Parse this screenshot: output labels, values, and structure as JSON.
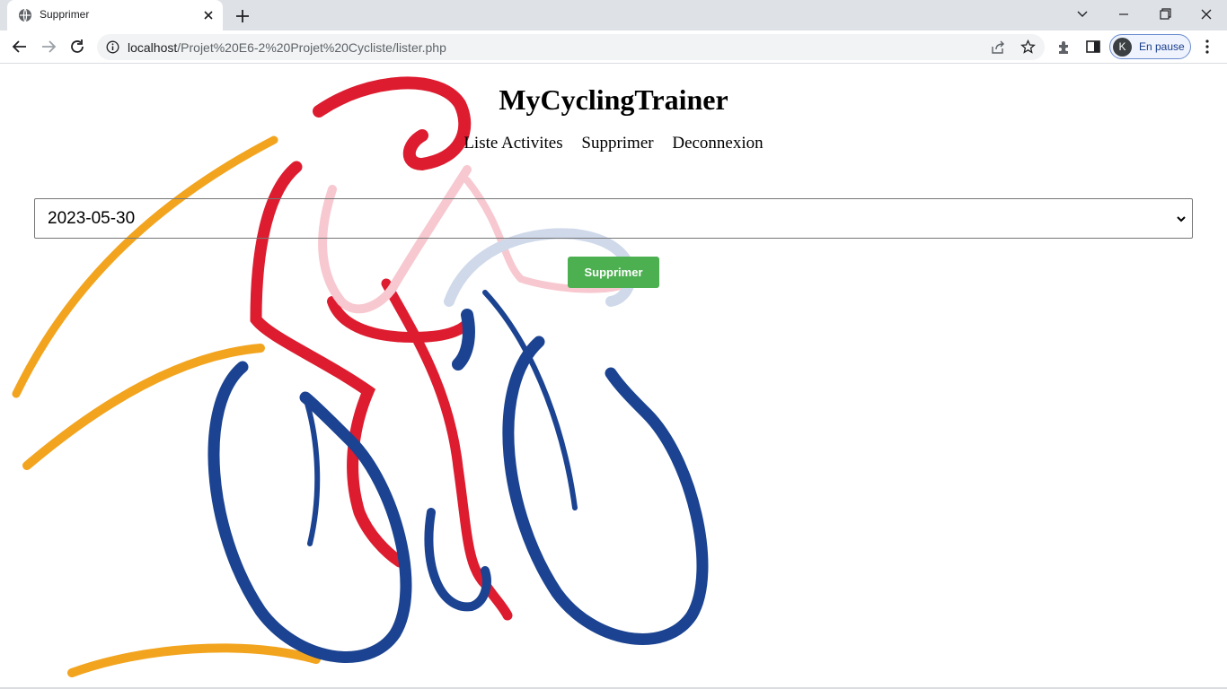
{
  "browser": {
    "tab": {
      "title": "Supprimer",
      "favicon": "globe-icon",
      "close_icon": "close-icon"
    },
    "new_tab_icon": "plus-icon",
    "window_controls": [
      "chevron-down-icon",
      "minimize-icon",
      "restore-icon",
      "close-icon"
    ],
    "url_host": "localhost",
    "url_path": "/Projet%20E6-2%20Projet%20Cycliste/lister.php",
    "profile": {
      "initial": "K",
      "status": "En pause"
    }
  },
  "page": {
    "title": "MyCyclingTrainer",
    "nav": [
      {
        "label": "Liste Activites"
      },
      {
        "label": "Supprimer"
      },
      {
        "label": "Deconnexion"
      }
    ],
    "date_select": {
      "selected": "2023-05-30"
    },
    "delete_button": "Supprimer"
  },
  "colors": {
    "button_green": "#4caf50",
    "art_red": "#dd1c2f",
    "art_blue": "#1b4391",
    "art_orange": "#f2a41e"
  }
}
